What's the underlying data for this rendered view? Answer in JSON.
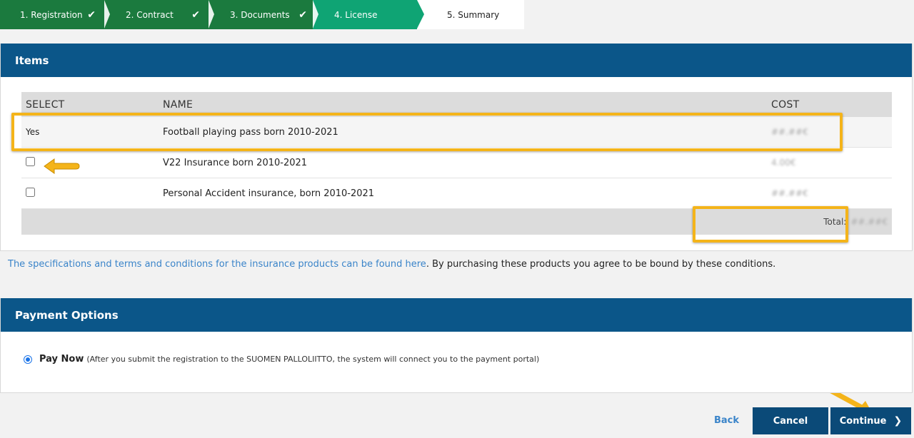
{
  "steps": [
    {
      "label": "1. Registration",
      "state": "done"
    },
    {
      "label": "2. Contract",
      "state": "done"
    },
    {
      "label": "3. Documents",
      "state": "done"
    },
    {
      "label": "4. License",
      "state": "active"
    },
    {
      "label": "5. Summary",
      "state": "pending"
    }
  ],
  "check_glyph": "✔",
  "items": {
    "title": "Items",
    "columns": {
      "select": "SELECT",
      "name": "NAME",
      "cost": "COST"
    },
    "rows": [
      {
        "select": "Yes",
        "name": "Football playing pass born 2010-2021",
        "cost": "##.##€"
      },
      {
        "select": "checkbox",
        "name": "V22 Insurance born 2010-2021",
        "cost": "4.00€"
      },
      {
        "select": "checkbox",
        "name": "Personal Accident insurance, born 2010-2021",
        "cost": "##.##€"
      }
    ],
    "total_label": "Total:",
    "total_value": "##.##€"
  },
  "terms": {
    "link_text": "The specifications and terms and conditions for the insurance products can be found here",
    "rest_text": ". By purchasing these products you agree to be bound by these conditions."
  },
  "payment": {
    "title": "Payment Options",
    "option_label": "Pay Now",
    "option_note": "(After you submit the registration to the SUOMEN PALLOLIITTO, the system will connect you to the payment portal)"
  },
  "footer": {
    "back_label": "Back",
    "cancel_label": "Cancel",
    "continue_label": "Continue",
    "continue_chevron": "❯"
  },
  "colors": {
    "header_blue": "#0b5689",
    "step_done": "#1b7a3e",
    "step_active": "#0fa474",
    "highlight": "#f4b41a",
    "link": "#3a84c9"
  }
}
